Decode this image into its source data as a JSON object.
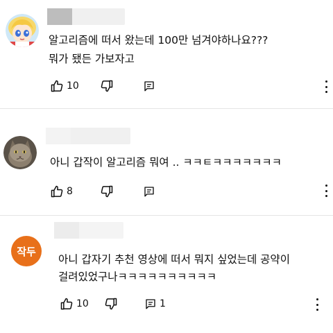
{
  "comments": [
    {
      "avatar_icon": "cartoon-girl-avatar-icon",
      "text_lines": [
        "알고리즘에 떠서 왔는데 100만 넘겨야하나요???",
        "뭐가 됐든 가보자고"
      ],
      "likes": "10",
      "replies": ""
    },
    {
      "avatar_icon": "cat-photo-avatar-icon",
      "text_lines": [
        "아니 갑작이 알고리즘 뭐여 .. ㅋㅋㅌㅋㅋㅋㅋㅋㅋㅋ"
      ],
      "likes": "8",
      "replies": ""
    },
    {
      "avatar_initials": "작두",
      "avatar_color": "#e8701a",
      "text_lines": [
        "아니 갑자기 추천 영상에 떠서 뭐지 싶었는데 공약이",
        "걸려있었구나ㅋㅋㅋㅋㅋㅋㅋㅋㅋㅋ"
      ],
      "likes": "10",
      "replies": "1"
    }
  ]
}
